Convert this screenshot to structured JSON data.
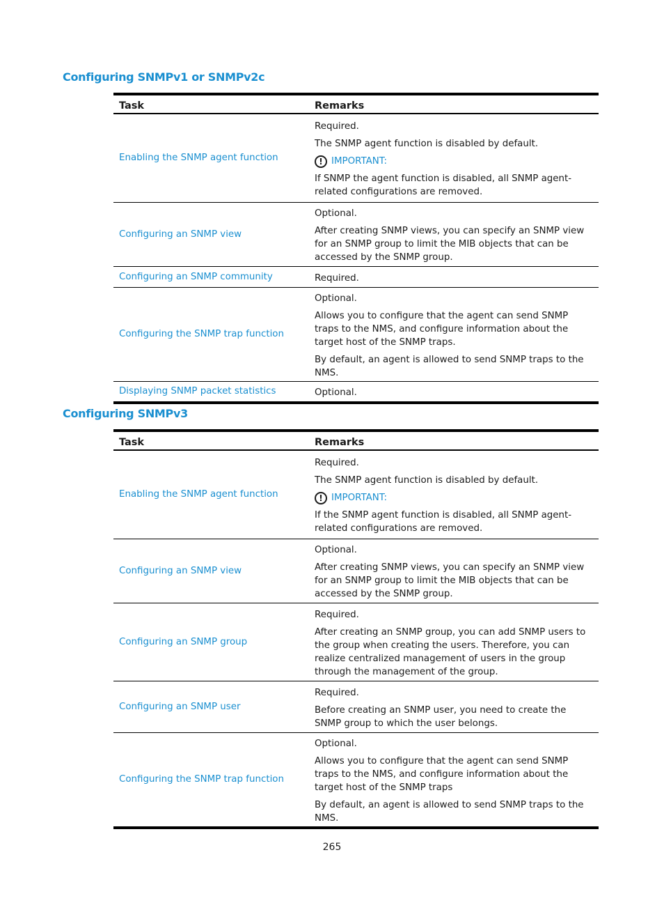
{
  "section1": {
    "title": "Configuring SNMPv1 or SNMPv2c",
    "headers": {
      "task": "Task",
      "remarks": "Remarks"
    },
    "rows": [
      {
        "task": "Enabling the SNMP agent function",
        "remarks": [
          "Required.",
          "The SNMP agent function is disabled by default."
        ],
        "important_label": "IMPORTANT:",
        "important_text": "If SNMP the agent function is disabled, all SNMP agent-related configurations are removed."
      },
      {
        "task": "Configuring an SNMP view",
        "remarks": [
          "Optional.",
          "After creating SNMP views, you can specify an SNMP view for an SNMP group to limit the MIB objects that can be accessed by the SNMP group."
        ]
      },
      {
        "task": "Configuring an SNMP community",
        "remarks": [
          "Required."
        ]
      },
      {
        "task": "Configuring the SNMP trap function",
        "remarks": [
          "Optional.",
          "Allows you to configure that the agent can send SNMP traps to the NMS, and configure information about the target host of the SNMP traps.",
          "By default, an agent is allowed to send SNMP traps to the NMS."
        ]
      },
      {
        "task": "Displaying SNMP packet statistics",
        "remarks": [
          "Optional."
        ]
      }
    ]
  },
  "section2": {
    "title": "Configuring SNMPv3",
    "headers": {
      "task": "Task",
      "remarks": "Remarks"
    },
    "rows": [
      {
        "task": "Enabling the SNMP agent function",
        "remarks": [
          "Required.",
          "The SNMP agent function is disabled by default."
        ],
        "important_label": "IMPORTANT:",
        "important_text": "If the SNMP agent function is disabled, all SNMP agent-related configurations are removed."
      },
      {
        "task": "Configuring an SNMP view",
        "remarks": [
          "Optional.",
          "After creating SNMP views, you can specify an SNMP view for an SNMP group to limit the MIB objects that can be accessed by the SNMP group."
        ]
      },
      {
        "task": "Configuring an SNMP group",
        "remarks": [
          "Required.",
          "After creating an SNMP group, you can add SNMP users to the group when creating the users. Therefore, you can realize centralized management of users in the group through the management of the group."
        ]
      },
      {
        "task": "Configuring an SNMP user",
        "remarks": [
          "Required.",
          "Before creating an SNMP user, you need to create the SNMP group to which the user belongs."
        ]
      },
      {
        "task": "Configuring the SNMP trap function",
        "remarks": [
          "Optional.",
          "Allows you to configure that the agent can send SNMP traps to the NMS, and configure information about the target host of the SNMP traps",
          "By default, an agent is allowed to send SNMP traps to the NMS."
        ]
      }
    ]
  },
  "icons": {
    "important": "exclamation-circle-icon"
  },
  "colors": {
    "accent": "#1a8fd0",
    "text": "#1a1a1a"
  },
  "page_number": "265"
}
